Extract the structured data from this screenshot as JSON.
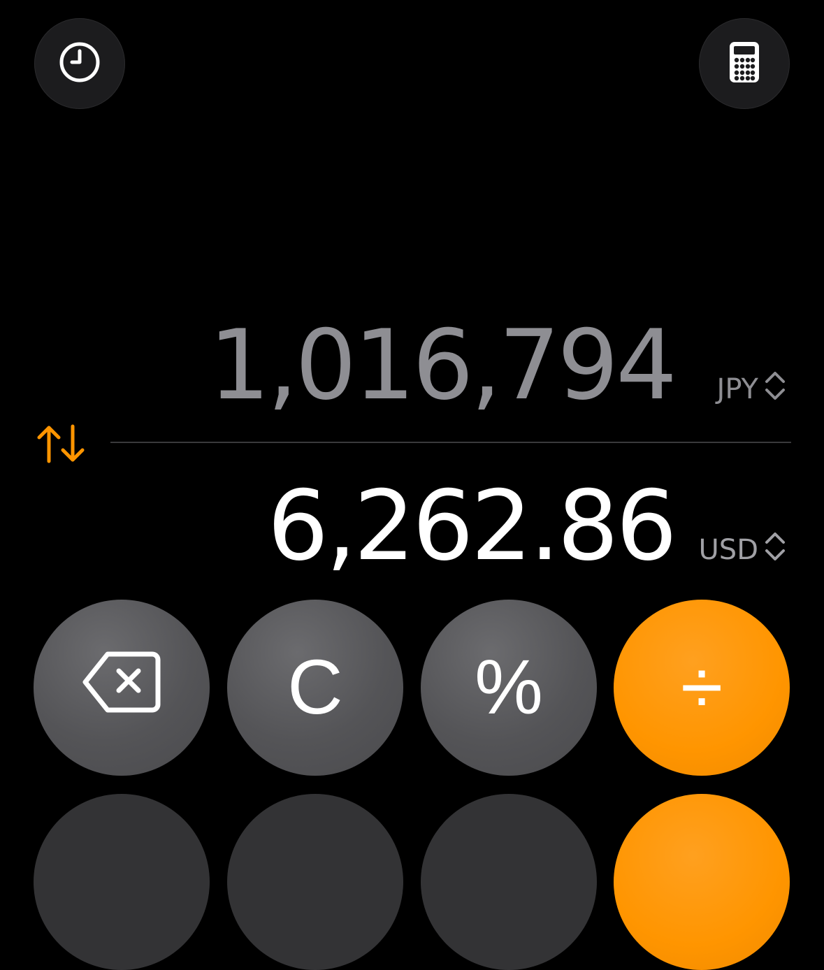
{
  "top_bar": {
    "history_icon": "clock-icon",
    "mode_icon": "calculator-icon"
  },
  "converter": {
    "source_amount": "1,016,794",
    "source_currency": "JPY",
    "target_amount": "6,262.86",
    "target_currency": "USD",
    "swap_icon": "swap-arrows-icon"
  },
  "keypad": {
    "row1": {
      "backspace_icon": "backspace-icon",
      "clear_label": "C",
      "percent_label": "%",
      "divide_label": "÷"
    }
  },
  "colors": {
    "accent": "#ff9500",
    "background": "#000000",
    "key_gray": "#5a5a5d",
    "secondary_text": "#8e8e93"
  }
}
